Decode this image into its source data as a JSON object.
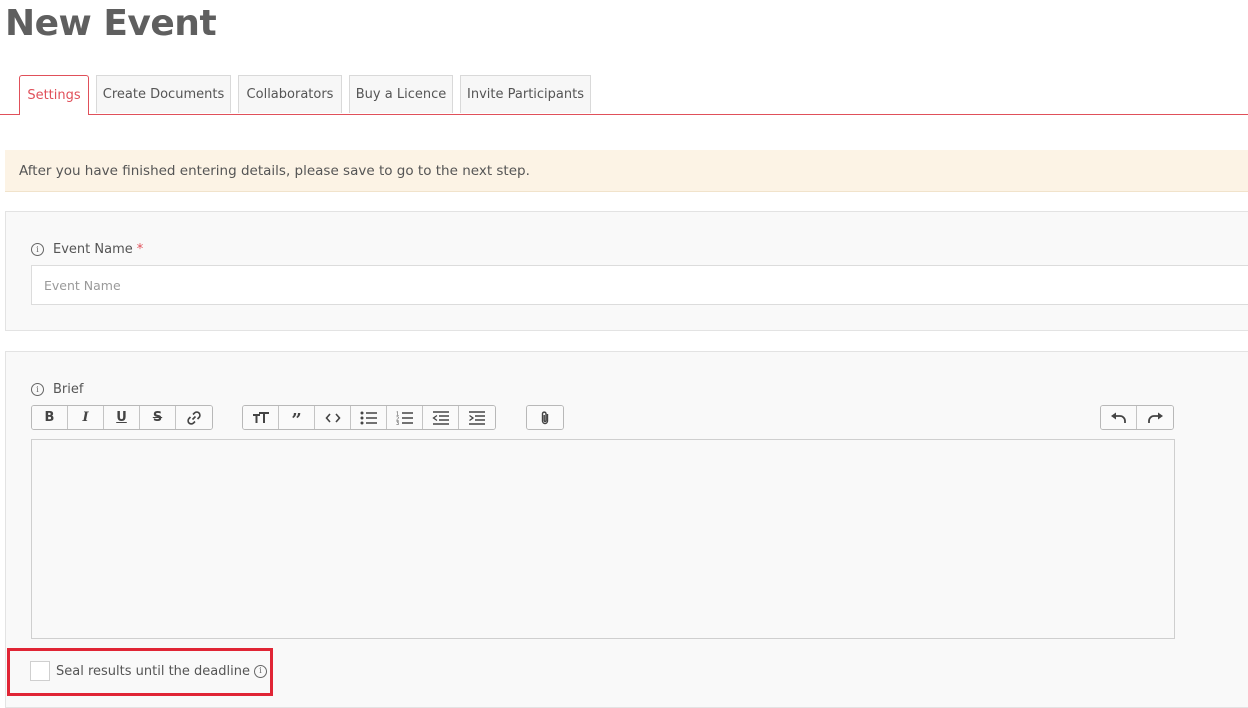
{
  "page": {
    "title": "New Event"
  },
  "tabs": [
    {
      "label": "Settings",
      "active": true
    },
    {
      "label": "Create Documents",
      "active": false
    },
    {
      "label": "Collaborators",
      "active": false
    },
    {
      "label": "Buy a Licence",
      "active": false
    },
    {
      "label": "Invite Participants",
      "active": false
    }
  ],
  "alert": {
    "text": "After you have finished entering details, please save to go to the next step."
  },
  "event_name": {
    "label": "Event Name",
    "required_marker": "*",
    "placeholder": "Event Name",
    "value": ""
  },
  "brief": {
    "label": "Brief",
    "toolbar": {
      "text_formatting": [
        "bold-icon",
        "italic-icon",
        "underline-icon",
        "strikethrough-icon",
        "link-icon"
      ],
      "block_formatting": [
        "heading-icon",
        "quote-icon",
        "code-icon",
        "bullet-list-icon",
        "numbered-list-icon",
        "outdent-icon",
        "indent-icon"
      ],
      "file_tools": [
        "attach-icon"
      ],
      "history": [
        "undo-icon",
        "redo-icon"
      ]
    },
    "content": ""
  },
  "seal_results": {
    "label": "Seal results until the deadline",
    "checked": false
  },
  "colors": {
    "accent": "#e0505a",
    "highlight_box": "#e02535",
    "alert_bg": "#fcf3e5"
  }
}
